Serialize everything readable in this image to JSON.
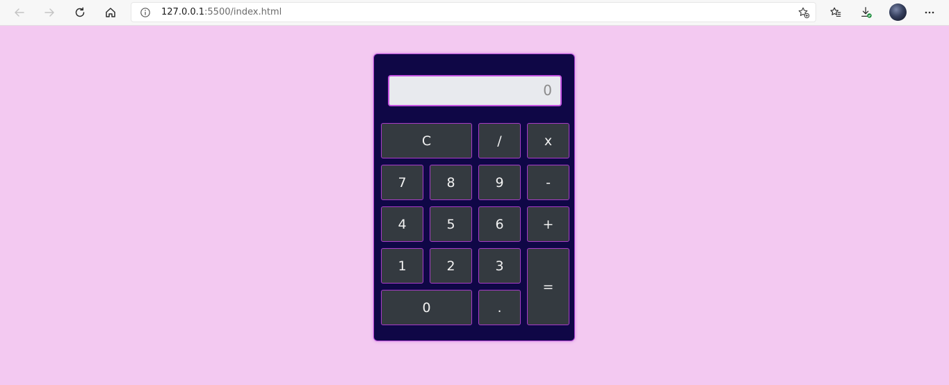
{
  "browser": {
    "url_host": "127.0.0.1",
    "url_rest": ":5500/index.html"
  },
  "calculator": {
    "display_value": "0",
    "keys": {
      "clear": "C",
      "divide": "/",
      "multiply": "x",
      "seven": "7",
      "eight": "8",
      "nine": "9",
      "minus": "-",
      "four": "4",
      "five": "5",
      "six": "6",
      "plus": "+",
      "one": "1",
      "two": "2",
      "three": "3",
      "equals": "=",
      "zero": "0",
      "decimal": "."
    }
  },
  "colors": {
    "page_background": "#f3c9f1",
    "calculator_body": "#0f0746",
    "key_background": "#343a40",
    "accent_border": "#b246d6"
  }
}
